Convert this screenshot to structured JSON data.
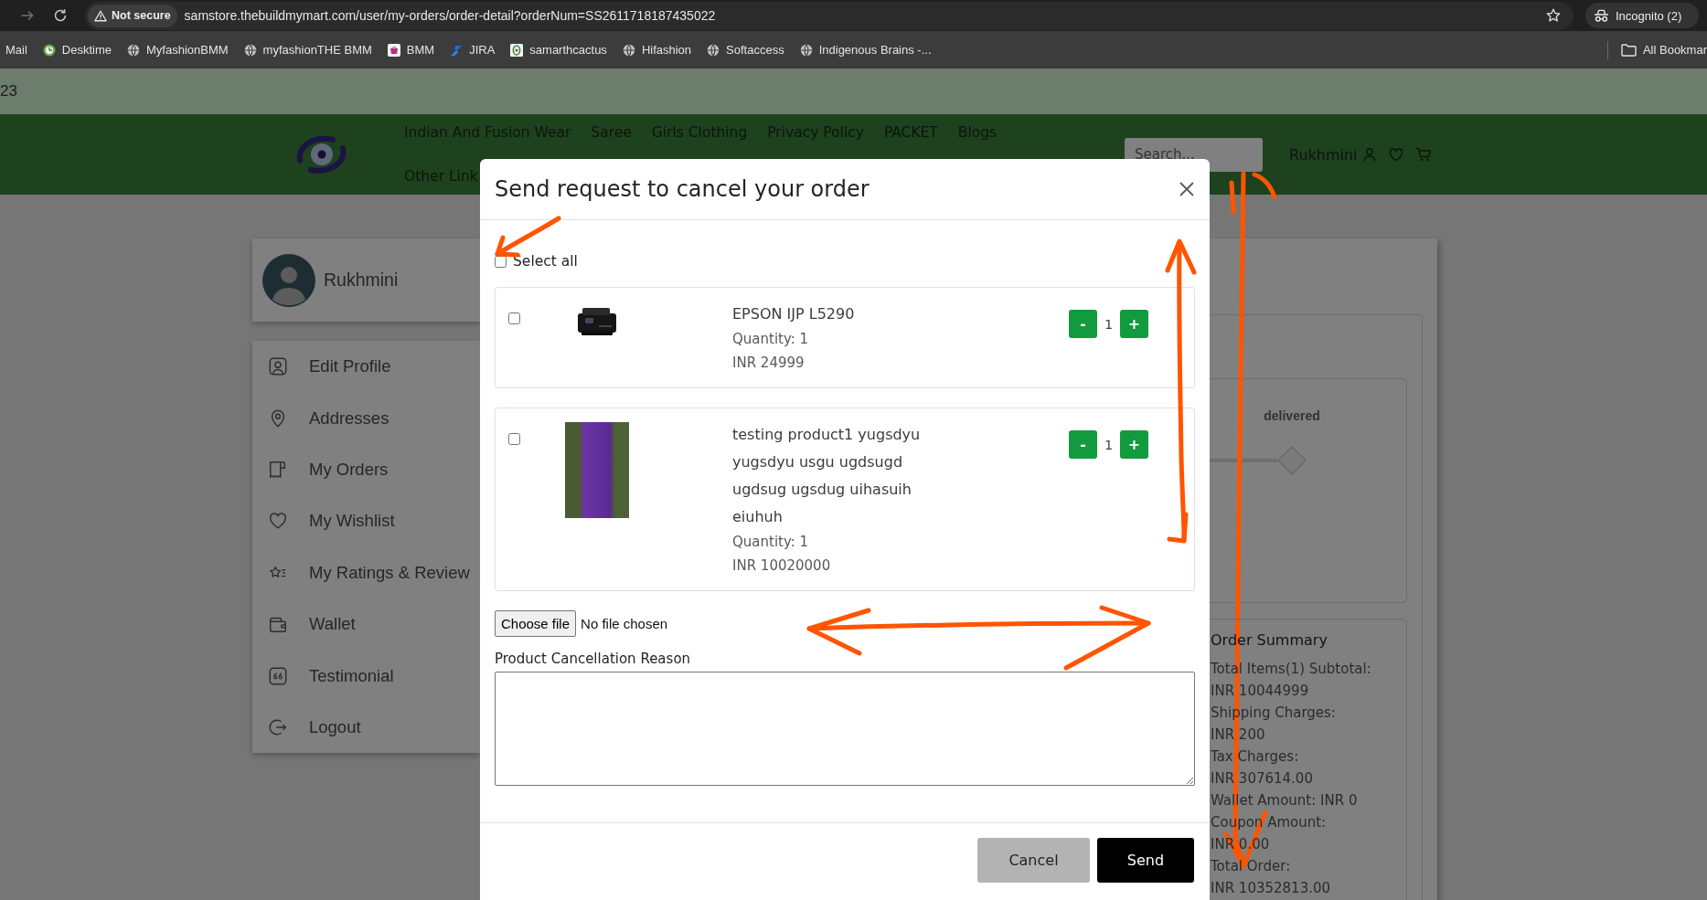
{
  "browser": {
    "security_label": "Not secure",
    "url": "samstore.thebuildmymart.com/user/my-orders/order-detail?orderNum=SS2611718187435022",
    "profile_label": "Incognito (2)"
  },
  "bookmarks": [
    {
      "label": "Mail"
    },
    {
      "label": "Desktime"
    },
    {
      "label": "MyfashionBMM"
    },
    {
      "label": "myfashionTHE BMM"
    },
    {
      "label": "BMM"
    },
    {
      "label": "JIRA"
    },
    {
      "label": "samarthcactus"
    },
    {
      "label": "Hifashion"
    },
    {
      "label": "Softaccess"
    },
    {
      "label": "Indigenous Brains -..."
    }
  ],
  "all_bookmarks": {
    "label": "All Bookmar"
  },
  "top_strip": {
    "text": "23"
  },
  "header": {
    "nav_links": [
      "Indian And Fusion Wear",
      "Saree",
      "Girls Clothing",
      "Privacy Policy",
      "PACKET",
      "Blogs",
      "Other Link"
    ],
    "search": {
      "placeholder": "Search..."
    },
    "user_name": "Rukhmini"
  },
  "profile": {
    "name": "Rukhmini"
  },
  "sidebar": {
    "items": [
      {
        "label": "Edit Profile"
      },
      {
        "label": "Addresses"
      },
      {
        "label": "My Orders"
      },
      {
        "label": "My Wishlist"
      },
      {
        "label": "My Ratings & Review"
      },
      {
        "label": "Wallet"
      },
      {
        "label": "Testimonial"
      },
      {
        "label": "Logout"
      }
    ]
  },
  "order_status": {
    "label": "delivered"
  },
  "order_summary": {
    "title": "Order Summary",
    "lines": [
      "Total Items(1) Subtotal:",
      "INR 10044999",
      "Shipping Charges:",
      "INR 200",
      "Tax Charges:",
      "INR 307614.00",
      "Wallet Amount: INR 0",
      "Coupon Amount:",
      "INR 0.00",
      "Total Order:",
      "INR 10352813.00"
    ]
  },
  "modal": {
    "title": "Send request to cancel your order",
    "select_all": {
      "label": "Select all",
      "checked": false
    },
    "items": [
      {
        "name": "EPSON IJP L5290",
        "quantity": "Quantity: 1",
        "price": "INR 24999",
        "checked": false,
        "stepper": {
          "minus": "-",
          "value": "1",
          "plus": "+"
        }
      },
      {
        "name": "testing product1 yugsdyu yugsdyu usgu ugdsugd ugdsug ugsdug uihasuih eiuhuh",
        "quantity": "Quantity: 1",
        "price": "INR 10020000",
        "checked": false,
        "stepper": {
          "minus": "-",
          "value": "1",
          "plus": "+"
        }
      }
    ],
    "file": {
      "button": "Choose file",
      "status": "No file chosen"
    },
    "reason": {
      "label": "Product Cancellation Reason"
    },
    "buttons": [
      {
        "label": "Cancel",
        "kind": "secondary"
      },
      {
        "label": "Send",
        "kind": "primary"
      }
    ]
  }
}
